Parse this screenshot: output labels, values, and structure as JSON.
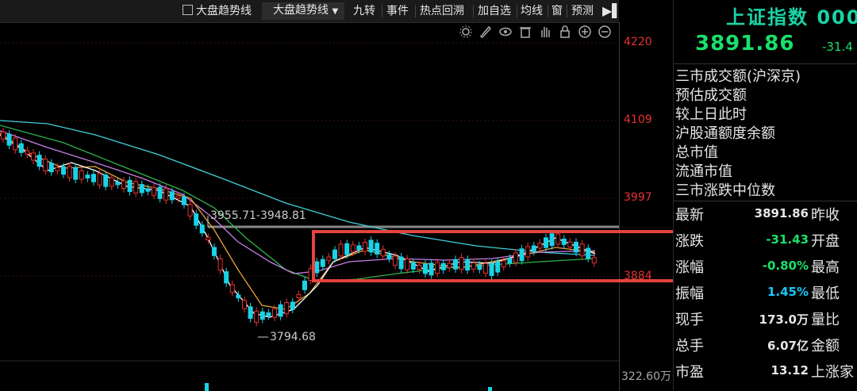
{
  "toolbar": {
    "checkbox_label": "大盘趋势线",
    "dropdown_label": "大盘趋势线",
    "items": [
      "九转",
      "事件",
      "热点回溯",
      "加自选",
      "均线",
      "窗",
      "预测"
    ]
  },
  "axis": {
    "y_ticks": [
      "4220",
      "4109",
      "3997",
      "3884"
    ],
    "volume_tick": "322.60万"
  },
  "annotations": {
    "range_label": "3955.71-3948.81",
    "low_label": "3794.68"
  },
  "side": {
    "title": "上证指数 000",
    "price": "3891.86",
    "change": "-31.4",
    "info_rows": [
      "三市成交额(沪深京)",
      "预估成交额",
      "较上日此时",
      "沪股通额度余额",
      "总市值",
      "流通市值",
      "三市涨跌中位数"
    ],
    "quote_rows": [
      {
        "label": "最新",
        "value": "3891.86",
        "value_color": "#e6e6e6",
        "label2": "昨收"
      },
      {
        "label": "涨跌",
        "value": "-31.43",
        "value_color": "#19e06a",
        "label2": "开盘"
      },
      {
        "label": "涨幅",
        "value": "-0.80%",
        "value_color": "#19e06a",
        "label2": "最高"
      },
      {
        "label": "振幅",
        "value": "1.45%",
        "value_color": "#19c6ff",
        "label2": "最低"
      },
      {
        "label": "现手",
        "value": "173.0万",
        "value_color": "#e6e6e6",
        "label2": "量比"
      },
      {
        "label": "总手",
        "value": "6.07亿",
        "value_color": "#e6e6e6",
        "label2": "金额"
      },
      {
        "label": "市盈",
        "value": "13.12",
        "value_color": "#e6e6e6",
        "label2": "上涨家"
      }
    ]
  },
  "colors": {
    "up": "#e83030",
    "down": "#19d3e6",
    "ma5": "#ffffff",
    "ma10": "#e8a33a",
    "ma20": "#c77ee8",
    "ma30": "#2bb34a",
    "ma60": "#3fd0d8",
    "highlight": "#e3443e"
  }
}
